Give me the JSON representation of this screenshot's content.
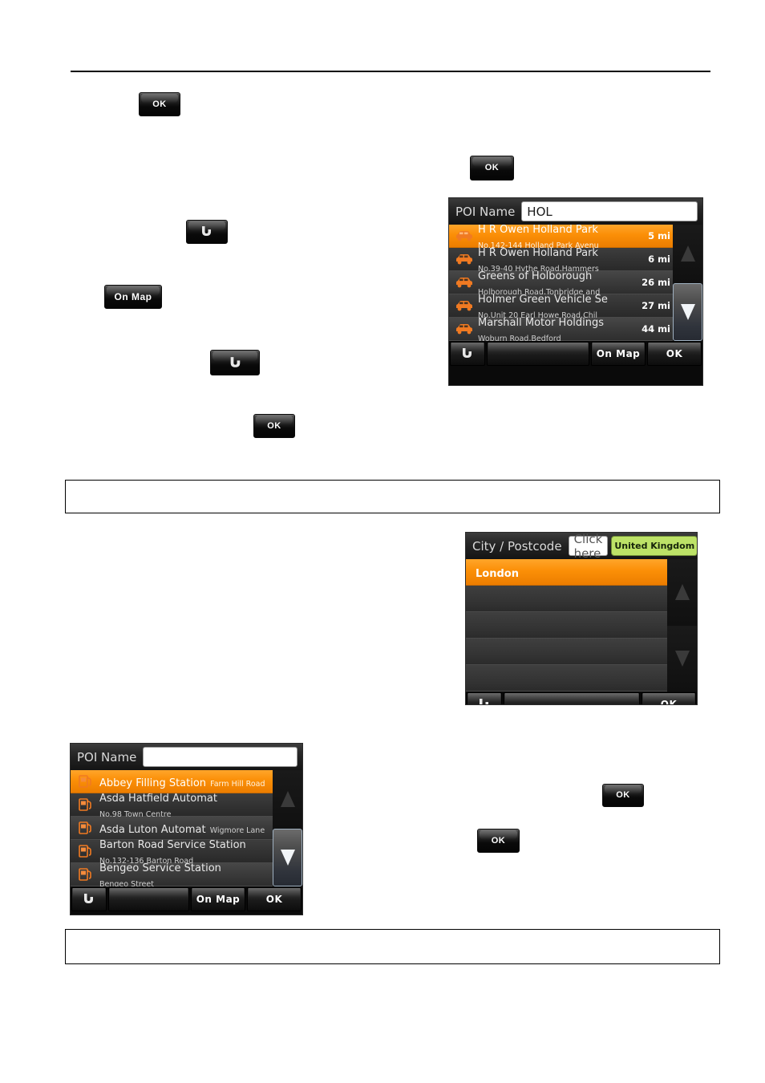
{
  "document": {
    "note_box_1_text": "",
    "note_box_2_text": ""
  },
  "inline_buttons": {
    "ok_1": "OK",
    "back_1": "back-arrow",
    "on_map_1": "On Map",
    "back_2": "back-arrow",
    "ok_2": "OK",
    "ok_3": "OK",
    "ok_4": "OK",
    "ok_5": "OK"
  },
  "devices": {
    "poi_hol": {
      "header_label": "POI Name",
      "field_value": "HOL",
      "rows": [
        {
          "icon": "car-icon",
          "name": "H R Owen Holland Park",
          "sub": "No.142-144 Holland Park Avenu",
          "dist": "5 mi",
          "selected": true
        },
        {
          "icon": "car-icon",
          "name": "H R Owen Holland Park",
          "sub": "No.39-40 Hythe Road,Hammers",
          "dist": "6 mi",
          "selected": false
        },
        {
          "icon": "car-icon",
          "name": "Greens of Holborough",
          "sub": "Holborough Road,Tonbridge and",
          "dist": "26 mi",
          "selected": false
        },
        {
          "icon": "car-icon",
          "name": "Holmer Green Vehicle Se",
          "sub": "No.Unit 20 Earl Howe Road,Chil",
          "dist": "27 mi",
          "selected": false
        },
        {
          "icon": "car-icon",
          "name": "Marshall Motor Holdings",
          "sub": "Woburn Road,Bedford",
          "dist": "44 mi",
          "selected": false
        }
      ],
      "scroll": {
        "up_state": "disabled",
        "down_state": "active"
      },
      "footer": {
        "back": "back-arrow",
        "on_map": "On Map",
        "ok": "OK"
      }
    },
    "city": {
      "header_label": "City / Postcode",
      "field_value": "Click here",
      "country_badge": "United Kingdom",
      "rows": [
        {
          "name": "London",
          "selected": true
        },
        {
          "name": "",
          "selected": false
        },
        {
          "name": "",
          "selected": false
        },
        {
          "name": "",
          "selected": false
        },
        {
          "name": "",
          "selected": false
        }
      ],
      "scroll": {
        "up_state": "disabled",
        "down_state": "disabled"
      },
      "footer": {
        "back": "back-arrow",
        "ok": "OK"
      }
    },
    "poi_fuel": {
      "header_label": "POI Name",
      "field_value": "",
      "rows": [
        {
          "icon": "fuel-pump-icon",
          "name": "Abbey Filling Station",
          "sub": "Farm Hill Road",
          "selected": true
        },
        {
          "icon": "fuel-pump-icon",
          "name": "Asda Hatfield Automat",
          "sub": "No.98 Town Centre",
          "selected": false
        },
        {
          "icon": "fuel-pump-icon",
          "name": "Asda Luton Automat",
          "sub": "Wigmore Lane",
          "selected": false
        },
        {
          "icon": "fuel-pump-icon",
          "name": "Barton Road Service Station",
          "sub": "No.132-136 Barton Road",
          "selected": false
        },
        {
          "icon": "fuel-pump-icon",
          "name": "Bengeo Service Station",
          "sub": "Bengeo Street",
          "selected": false
        }
      ],
      "scroll": {
        "up_state": "disabled",
        "down_state": "active"
      },
      "footer": {
        "back": "back-arrow",
        "on_map": "On Map",
        "ok": "OK"
      }
    }
  },
  "colors": {
    "selection_orange": "#fb8f07",
    "badge_green": "#bde267",
    "device_dark": "#0a0a0a",
    "row_grey": "#3a3a3a"
  }
}
